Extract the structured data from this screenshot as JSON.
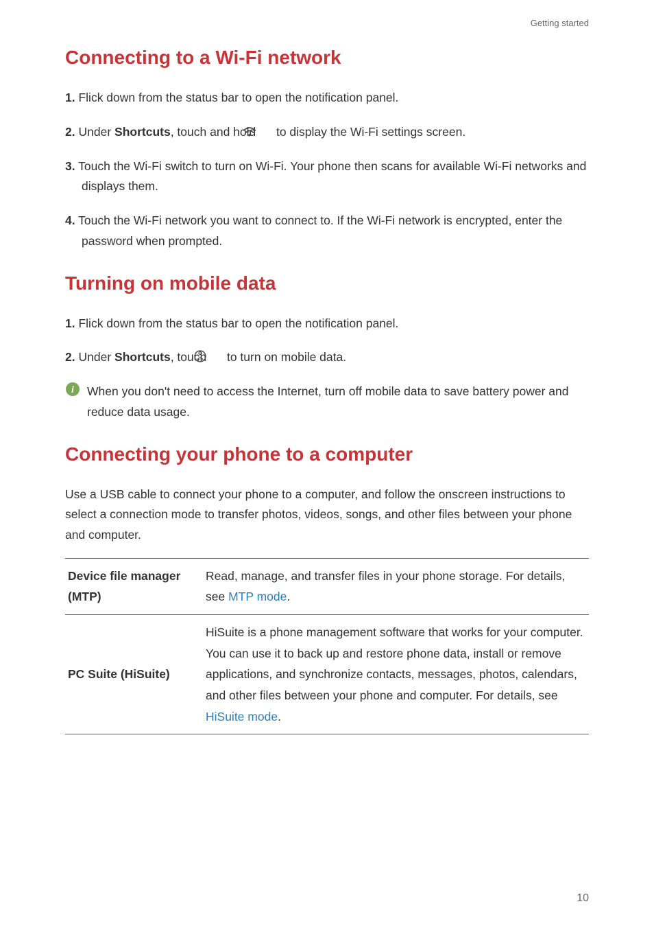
{
  "breadcrumb": "Getting started",
  "page_number": "10",
  "sections": {
    "wifi": {
      "title": "Connecting to a Wi-Fi network",
      "steps": [
        {
          "num": "1.",
          "text": "Flick down from the status bar to open the notification panel."
        },
        {
          "num": "2.",
          "prefix": "Under ",
          "bold": "Shortcuts",
          "mid": ", touch and hold ",
          "icon": "wifi-icon",
          "suffix": " to display the Wi-Fi settings screen."
        },
        {
          "num": "3.",
          "text": "Touch the Wi-Fi switch to turn on Wi-Fi. Your phone then scans for available Wi-Fi networks and displays them."
        },
        {
          "num": "4.",
          "text": "Touch the Wi-Fi network you want to connect to. If the Wi-Fi network is encrypted, enter the password when prompted."
        }
      ]
    },
    "mobile": {
      "title": "Turning on mobile data",
      "steps": [
        {
          "num": "1.",
          "text": "Flick down from the status bar to open the notification panel."
        },
        {
          "num": "2.",
          "prefix": "Under ",
          "bold": "Shortcuts",
          "mid": ", touch ",
          "icon": "mobile-data-icon",
          "suffix": " to turn on mobile data."
        }
      ],
      "note": "When you don't need to access the Internet, turn off mobile data to save battery power and reduce data usage."
    },
    "computer": {
      "title": "Connecting your phone to a computer",
      "intro": "Use a USB cable to connect your phone to a computer, and follow the onscreen instructions to select a connection mode to transfer photos, videos, songs, and other files between your phone and computer.",
      "rows": [
        {
          "label": "Device file manager (MTP)",
          "desc_pre": "Read, manage, and transfer files in your phone storage. For details, see ",
          "link": "MTP mode",
          "desc_post": "."
        },
        {
          "label": "PC Suite (HiSuite)",
          "desc_pre": "HiSuite is a phone management software that works for your computer. You can use it to back up and restore phone data, install or remove applications, and synchronize contacts, messages, photos, calendars, and other files between your phone and computer. For details, see ",
          "link": "HiSuite mode",
          "desc_post": "."
        }
      ]
    }
  }
}
